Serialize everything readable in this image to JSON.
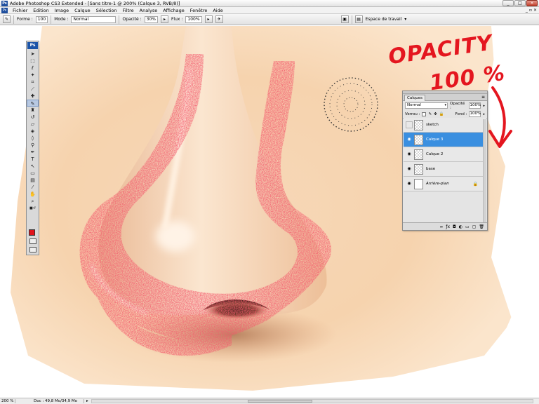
{
  "window": {
    "title": "Adobe Photoshop CS3 Extended - [Sans titre-1 @ 200% (Calque 3, RVB/8)]",
    "app_icon": "Ps",
    "buttons": [
      "_",
      "□",
      "×"
    ]
  },
  "menubar": {
    "items": [
      "Fichier",
      "Edition",
      "Image",
      "Calque",
      "Sélection",
      "Filtre",
      "Analyse",
      "Affichage",
      "Fenêtre",
      "Aide"
    ]
  },
  "options": {
    "brush_label": "Forme :",
    "brush_size": "100",
    "mode_label": "Mode :",
    "mode_value": "Normal",
    "opacity_label": "Opacité :",
    "opacity_value": "30%",
    "flow_label": "Flux :",
    "flow_value": "100%",
    "workspace_label": "Espace de travail"
  },
  "toolbox": {
    "logo": "Ps",
    "foreground_color": "#e0131b"
  },
  "annotation": {
    "line1": "OPACITY",
    "line2": "100 %",
    "color": "#e4161f"
  },
  "layers_panel": {
    "tab": "Calques",
    "blend_mode": "Normal",
    "opacity_label": "Opacité :",
    "opacity_value": "100%",
    "lock_label": "Verrou :",
    "fill_label": "Fond :",
    "fill_value": "100%",
    "layers": [
      {
        "name": "sketch",
        "visible": false,
        "active": false
      },
      {
        "name": "Calque 3",
        "visible": true,
        "active": true
      },
      {
        "name": "Calque 2",
        "visible": true,
        "active": false
      },
      {
        "name": "base",
        "visible": true,
        "active": false
      },
      {
        "name": "Arrière-plan",
        "visible": true,
        "active": false,
        "locked": true
      }
    ],
    "active_color": "#3a8fe0"
  },
  "statusbar": {
    "zoom": "200 %",
    "doc_info": "Doc : 49,8 Mo/34,9 Mo"
  }
}
